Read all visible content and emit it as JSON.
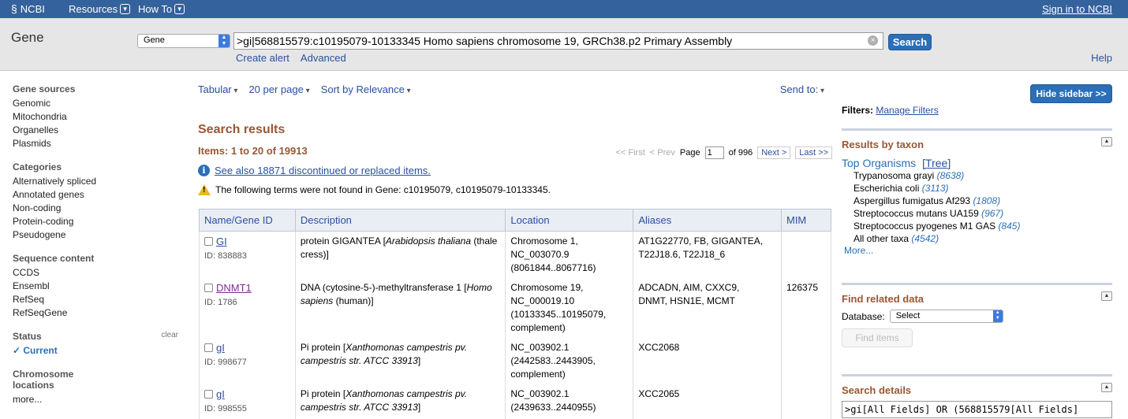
{
  "topbar": {
    "logo": "NCBI",
    "resources": "Resources",
    "howto": "How To",
    "signin": "Sign in to NCBI"
  },
  "search": {
    "db_title": "Gene",
    "db_select": "Gene",
    "term": ">gi|568815579:c10195079-10133345 Homo sapiens chromosome 19, GRCh38.p2 Primary Assembly",
    "search_label": "Search",
    "create_alert": "Create alert",
    "advanced": "Advanced",
    "help": "Help"
  },
  "leftnav": {
    "gene_sources": {
      "title": "Gene sources",
      "items": [
        "Genomic",
        "Mitochondria",
        "Organelles",
        "Plasmids"
      ]
    },
    "categories": {
      "title": "Categories",
      "items": [
        "Alternatively spliced",
        "Annotated genes",
        "Non-coding",
        "Protein-coding",
        "Pseudogene"
      ]
    },
    "sequence_content": {
      "title": "Sequence content",
      "items": [
        "CCDS",
        "Ensembl",
        "RefSeq",
        "RefSeqGene"
      ]
    },
    "status": {
      "title": "Status",
      "clear": "clear",
      "current": "Current"
    },
    "chromosome": {
      "title_line1": "Chromosome",
      "title_line2": "locations",
      "more": "more..."
    }
  },
  "toolbar": {
    "format": "Tabular",
    "per_page": "20 per page",
    "sort": "Sort by Relevance",
    "send_to": "Send to:"
  },
  "results": {
    "title": "Search results",
    "items": "Items: 1 to 20 of 19913",
    "pager": {
      "first": "<< First",
      "prev": "< Prev",
      "page_label": "Page",
      "page": "1",
      "of": "of 996",
      "next": "Next >",
      "last": "Last >>"
    },
    "see_also": "See also 18871 discontinued or replaced items.",
    "warning": "The following terms were not found in Gene: c10195079, c10195079-10133345.",
    "columns": [
      "Name/Gene ID",
      "Description",
      "Location",
      "Aliases",
      "MIM"
    ],
    "rows": [
      {
        "name": "GI",
        "id": "ID: 838883",
        "desc_plain": "protein GIGANTEA [",
        "desc_italic": "Arabidopsis thaliana",
        "desc_tail": " (thale cress)]",
        "loc1": "Chromosome 1,",
        "loc2": "NC_003070.9",
        "loc3": "(8061844..8067716)",
        "loc4": "",
        "aliases1": "AT1G22770, FB, GIGANTEA,",
        "aliases2": "T22J18.6, T22J18_6",
        "mim": ""
      },
      {
        "name": "DNMT1",
        "id": "ID: 1786",
        "desc_plain": "DNA (cytosine-5-)-methyltransferase 1 [",
        "desc_italic": "Homo sapiens",
        "desc_tail": " (human)]",
        "loc1": "Chromosome 19,",
        "loc2": "NC_000019.10",
        "loc3": "(10133345..10195079,",
        "loc4": "complement)",
        "aliases1": "ADCADN, AIM, CXXC9,",
        "aliases2": "DNMT, HSN1E, MCMT",
        "mim": "126375"
      },
      {
        "name": "gI",
        "id": "ID: 998677",
        "desc_plain": "Pi protein [",
        "desc_italic": "Xanthomonas campestris pv. campestris str. ATCC 33913",
        "desc_tail": "]",
        "loc1": "NC_003902.1",
        "loc2": "(2442583..2443905,",
        "loc3": "complement)",
        "loc4": "",
        "aliases1": "XCC2068",
        "aliases2": "",
        "mim": ""
      },
      {
        "name": "gI",
        "id": "ID: 998555",
        "desc_plain": "Pi protein [",
        "desc_italic": "Xanthomonas campestris pv. campestris str. ATCC 33913",
        "desc_tail": "]",
        "loc1": "NC_003902.1",
        "loc2": "(2439633..2440955)",
        "loc3": "",
        "loc4": "",
        "aliases1": "XCC2065",
        "aliases2": "",
        "mim": ""
      }
    ]
  },
  "sidebar": {
    "hide": "Hide sidebar >>",
    "filters_label": "Filters:",
    "manage_filters": "Manage Filters",
    "taxon": {
      "title": "Results by taxon",
      "top": "Top Organisms",
      "tree": "[Tree]",
      "orgs": [
        {
          "name": "Trypanosoma grayi",
          "count": "(8638)"
        },
        {
          "name": "Escherichia coli",
          "count": "(3113)"
        },
        {
          "name": "Aspergillus fumigatus Af293",
          "count": "(1808)"
        },
        {
          "name": "Streptococcus mutans UA159",
          "count": "(967)"
        },
        {
          "name": "Streptococcus pyogenes M1 GAS",
          "count": "(845)"
        },
        {
          "name": "All other taxa",
          "count": "(4542)"
        }
      ],
      "more": "More..."
    },
    "related": {
      "title": "Find related data",
      "db_label": "Database:",
      "select": "Select",
      "find": "Find items"
    },
    "details": {
      "title": "Search details",
      "query": ">gi[All Fields] OR (568815579[All Fields]"
    }
  }
}
